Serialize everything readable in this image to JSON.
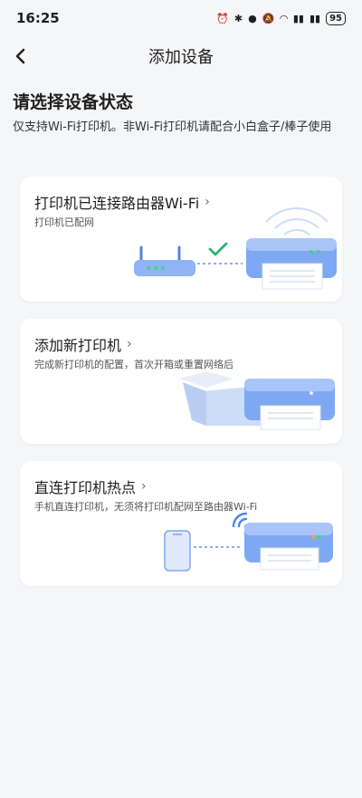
{
  "status": {
    "time": "16:25",
    "battery": "95"
  },
  "nav": {
    "title": "添加设备"
  },
  "main": {
    "heading": "请选择设备状态",
    "description": "仅支持Wi-Fi打印机。非Wi-Fi打印机请配合小白盒子/棒子使用"
  },
  "cards": [
    {
      "title": "打印机已连接路由器Wi-Fi",
      "subtitle": "打印机已配网"
    },
    {
      "title": "添加新打印机",
      "subtitle": "完成新打印机的配置，首次开箱或重置网络后"
    },
    {
      "title": "直连打印机热点",
      "subtitle": "手机直连打印机，无须将打印机配网至路由器Wi-Fi"
    }
  ],
  "colors": {
    "accent": "#4a86ea",
    "printer_body": "#7fa8f2",
    "check": "#2bb673"
  }
}
